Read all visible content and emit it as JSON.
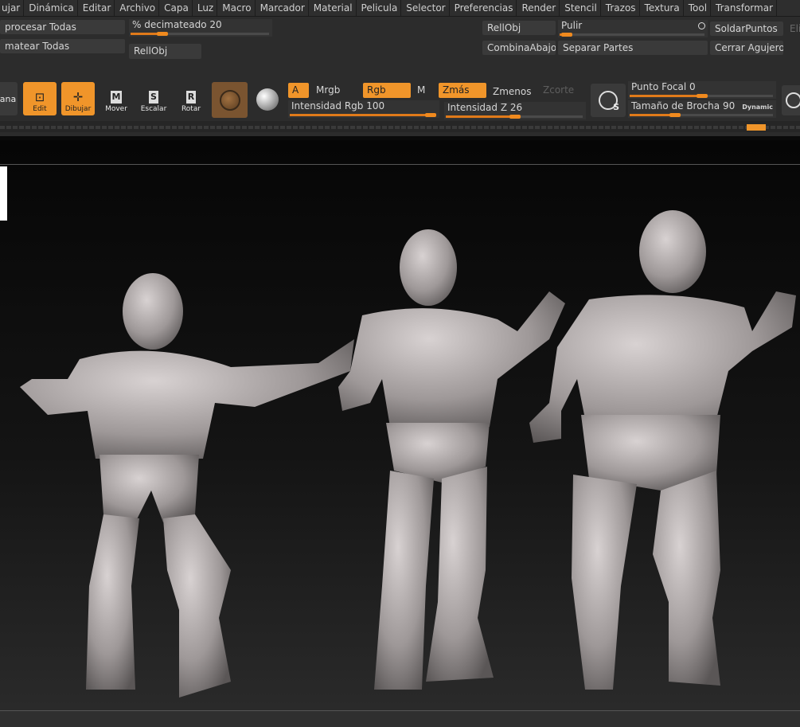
{
  "menu": [
    "ujar",
    "Dinámica",
    "Editar",
    "Archivo",
    "Capa",
    "Luz",
    "Macro",
    "Marcador",
    "Material",
    "Pelicula",
    "Selector",
    "Preferencias",
    "Render",
    "Stencil",
    "Trazos",
    "Textura",
    "Tool",
    "Transformar"
  ],
  "left_buttons": {
    "procesar": "procesar Todas",
    "matear": "matear Todas",
    "rellobj": "RellObj"
  },
  "decimateado": {
    "label": "% decimateado",
    "value": "20"
  },
  "right_buttons": {
    "rellobj": "RellObj",
    "pulir": "Pulir",
    "soldar": "SoldarPuntos",
    "eli": "Eli",
    "combina": "CombinaAbajo",
    "separar": "Separar Partes",
    "cerrar": "Cerrar Agujeros"
  },
  "tools": {
    "ventana": "ana",
    "edit": "Edit",
    "dibujar": "Dibujar",
    "mover": "Mover",
    "escalar": "Escalar",
    "rotar": "Rotar",
    "mover_key": "M",
    "escalar_key": "S",
    "rotar_key": "R"
  },
  "modes": {
    "a": "A",
    "mrgb": "Mrgb",
    "rgb": "Rgb",
    "m": "M",
    "zmas": "Zmás",
    "zmenos": "Zmenos",
    "zcorte": "Zcorte"
  },
  "intensidad_rgb": {
    "label": "Intensidad Rgb",
    "value": "100"
  },
  "intensidad_z": {
    "label": "Intensidad Z",
    "value": "26"
  },
  "punto_focal": {
    "label": "Punto Focal",
    "value": "0"
  },
  "tamano_brocha": {
    "label": "Tamaño de Brocha",
    "value": "90"
  },
  "dynamic": "Dynamic",
  "brush_s": "S",
  "colors": {
    "accent": "#f0952a",
    "panel": "#2c2c2c",
    "viewport": "#0a0a0a"
  }
}
